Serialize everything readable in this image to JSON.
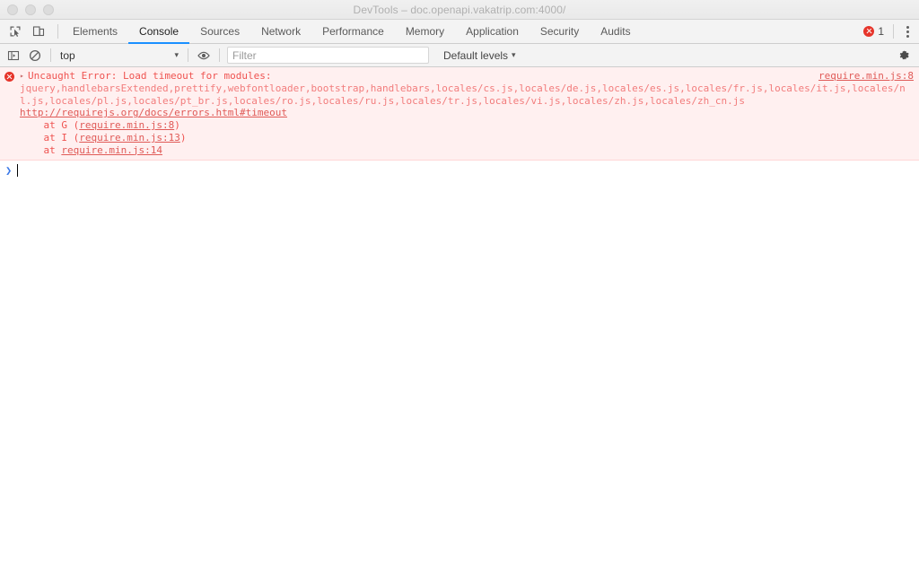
{
  "window": {
    "title": "DevTools – doc.openapi.vakatrip.com:4000/",
    "traffic_lights": [
      "close",
      "minimize",
      "maximize"
    ]
  },
  "tabbar": {
    "icons": [
      {
        "name": "inspect-element-icon",
        "label": "Inspect element"
      },
      {
        "name": "device-toolbar-icon",
        "label": "Toggle device toolbar"
      }
    ],
    "tabs": [
      {
        "label": "Elements",
        "active": false
      },
      {
        "label": "Console",
        "active": true
      },
      {
        "label": "Sources",
        "active": false
      },
      {
        "label": "Network",
        "active": false
      },
      {
        "label": "Performance",
        "active": false
      },
      {
        "label": "Memory",
        "active": false
      },
      {
        "label": "Application",
        "active": false
      },
      {
        "label": "Security",
        "active": false
      },
      {
        "label": "Audits",
        "active": false
      }
    ],
    "error_count": "1",
    "more_options_label": "Customize and control DevTools",
    "active_underline_color": "#1a90ff"
  },
  "console_toolbar": {
    "sidebar_toggle_label": "Show console sidebar",
    "clear_label": "Clear console",
    "context": "top",
    "context_caret": "▾",
    "eye_label": "Create live expression",
    "filter_placeholder": "Filter",
    "filter_value": "",
    "levels_label": "Default levels",
    "levels_caret": "▾",
    "settings_label": "Console settings"
  },
  "console": {
    "messages": [
      {
        "type": "error",
        "icon": "error-circle-icon",
        "disclosure": "▸",
        "headline": "Uncaught Error: Load timeout for modules:",
        "modules": "jquery,handlebarsExtended,prettify,webfontloader,bootstrap,handlebars,locales/cs.js,locales/de.js,locales/es.js,locales/fr.js,locales/it.js,locales/nl.js,locales/pl.js,locales/pt_br.js,locales/ro.js,locales/ru.js,locales/tr.js,locales/vi.js,locales/zh.js,locales/zh_cn.js",
        "help_link": "http://requirejs.org/docs/errors.html#timeout",
        "source_link": "require.min.js:8",
        "stack": [
          {
            "prefix": "    at ",
            "fn": "G (",
            "loc": "require.min.js:8",
            "suffix": ")"
          },
          {
            "prefix": "    at ",
            "fn": "I (",
            "loc": "require.min.js:13",
            "suffix": ")"
          },
          {
            "prefix": "    at ",
            "fn": "",
            "loc": "require.min.js:14",
            "suffix": ""
          }
        ]
      }
    ],
    "prompt": {
      "chevron": "❯",
      "value": ""
    }
  },
  "colors": {
    "error_bg": "#fff0f0",
    "error_text": "#ef5350",
    "error_icon": "#e6342a",
    "accent_blue": "#1a90ff",
    "prompt_blue": "#3b78e7",
    "toolbar_bg": "#f3f3f3",
    "titlebar_bg": "#efefef"
  }
}
